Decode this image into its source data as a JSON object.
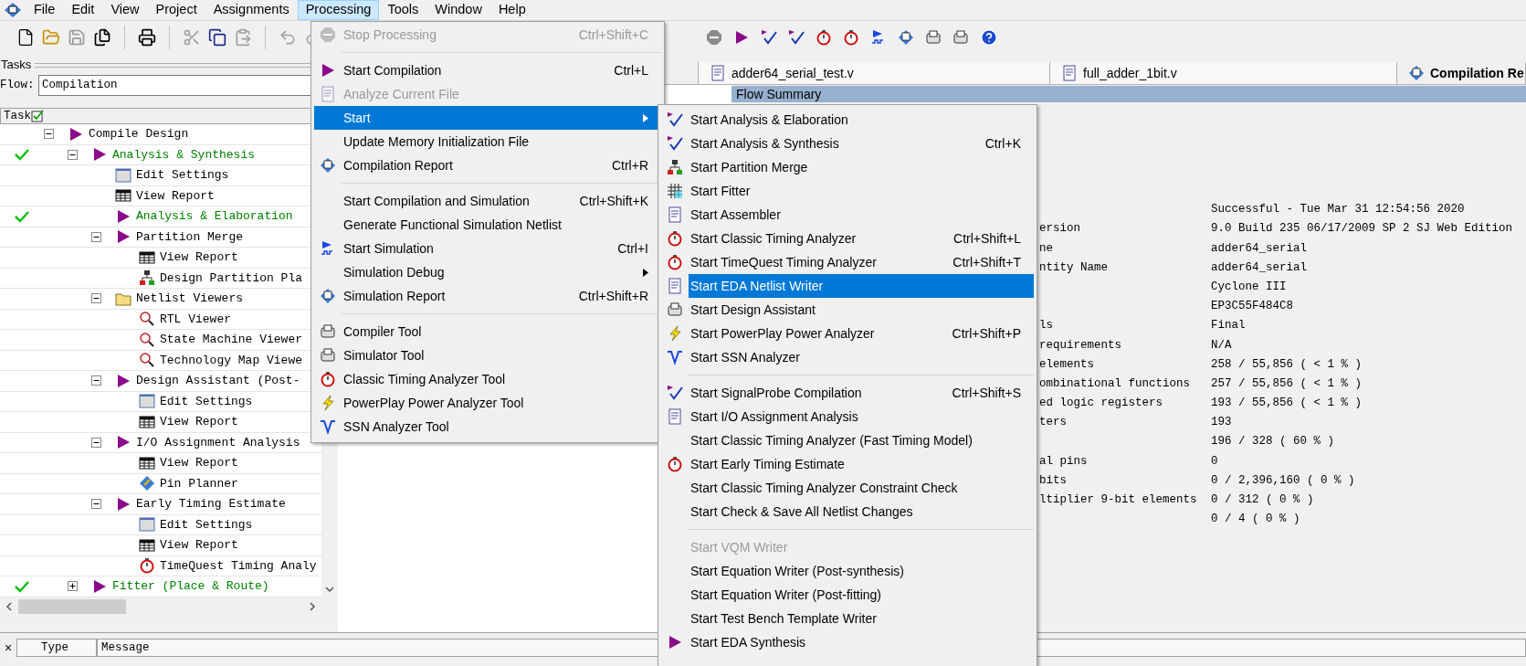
{
  "menubar": [
    {
      "label": "File",
      "selected": false
    },
    {
      "label": "Edit",
      "selected": false
    },
    {
      "label": "View",
      "selected": false
    },
    {
      "label": "Project",
      "selected": false
    },
    {
      "label": "Assignments",
      "selected": false
    },
    {
      "label": "Processing",
      "selected": true
    },
    {
      "label": "Tools",
      "selected": false
    },
    {
      "label": "Window",
      "selected": false
    },
    {
      "label": "Help",
      "selected": false
    }
  ],
  "tasks_panel": {
    "title": "Tasks",
    "flow_label": "Flow:",
    "flow_value": "Compilation",
    "column": "Task",
    "tree": [
      {
        "label": "Compile Design",
        "kind": "task",
        "done": false,
        "expanded": true,
        "children": [
          {
            "label": "Analysis & Synthesis",
            "kind": "task",
            "done": true,
            "expanded": true,
            "children": [
              {
                "label": "Edit Settings",
                "kind": "settings",
                "done": false
              },
              {
                "label": "View Report",
                "kind": "report",
                "done": false
              },
              {
                "label": "Analysis & Elaboration",
                "kind": "task",
                "done": true
              },
              {
                "label": "Partition Merge",
                "kind": "task",
                "done": false,
                "expanded": true,
                "children": [
                  {
                    "label": "View Report",
                    "kind": "report",
                    "done": false
                  },
                  {
                    "label": "Design Partition Pla",
                    "kind": "partition",
                    "done": false
                  }
                ]
              },
              {
                "label": "Netlist Viewers",
                "kind": "folder",
                "done": false,
                "expanded": true,
                "children": [
                  {
                    "label": "RTL Viewer",
                    "kind": "viewer",
                    "done": false
                  },
                  {
                    "label": "State Machine Viewer",
                    "kind": "viewer",
                    "done": false
                  },
                  {
                    "label": "Technology Map Viewe",
                    "kind": "viewer",
                    "done": false
                  }
                ]
              },
              {
                "label": "Design Assistant (Post-",
                "kind": "task",
                "done": false,
                "expanded": true,
                "children": [
                  {
                    "label": "Edit Settings",
                    "kind": "settings",
                    "done": false
                  },
                  {
                    "label": "View Report",
                    "kind": "report",
                    "done": false
                  }
                ]
              },
              {
                "label": "I/O Assignment Analysis",
                "kind": "task",
                "done": false,
                "expanded": true,
                "children": [
                  {
                    "label": "View Report",
                    "kind": "report",
                    "done": false
                  },
                  {
                    "label": "Pin Planner",
                    "kind": "planner",
                    "done": false
                  }
                ]
              },
              {
                "label": "Early Timing Estimate",
                "kind": "task",
                "done": false,
                "expanded": true,
                "children": [
                  {
                    "label": "Edit Settings",
                    "kind": "settings",
                    "done": false
                  },
                  {
                    "label": "View Report",
                    "kind": "report",
                    "done": false
                  },
                  {
                    "label": "TimeQuest Timing Analy",
                    "kind": "timing",
                    "done": false
                  }
                ]
              }
            ]
          },
          {
            "label": "Fitter (Place & Route)",
            "kind": "task",
            "done": true,
            "expanded": false
          }
        ]
      }
    ]
  },
  "tabs": [
    {
      "label": "adder64_serial_test.v",
      "selected": false
    },
    {
      "label": "full_adder_1bit.v",
      "selected": false
    },
    {
      "label": "Compilation Re",
      "selected": true
    }
  ],
  "summary": {
    "title": "Flow Summary",
    "rows": [
      {
        "value": "Successful - Tue Mar 31 12:54:56 2020"
      },
      {
        "label": "ersion",
        "value": "9.0 Build 235 06/17/2009 SP 2 SJ Web Edition"
      },
      {
        "label": "ne",
        "value": "adder64_serial"
      },
      {
        "label": "ntity Name",
        "value": "adder64_serial"
      },
      {
        "value": "Cyclone III"
      },
      {
        "value": "EP3C55F484C8"
      },
      {
        "label": "ls",
        "value": "Final"
      },
      {
        "label": "requirements",
        "value": "N/A"
      },
      {
        "label": "elements",
        "value": "258 / 55,856 ( < 1 % )"
      },
      {
        "label": "ombinational functions",
        "value": "257 / 55,856 ( < 1 % )"
      },
      {
        "label": "ed logic registers",
        "value": "193 / 55,856 ( < 1 % )"
      },
      {
        "label": "ters",
        "value": "193"
      },
      {
        "value": "196 / 328 ( 60 % )"
      },
      {
        "label": "al pins",
        "value": "0"
      },
      {
        "label": "bits",
        "value": "0 / 2,396,160 ( 0 % )"
      },
      {
        "label": "ltiplier 9-bit elements",
        "value": "0 / 312 ( 0 % )"
      },
      {
        "value": "0 / 4 ( 0 % )"
      }
    ]
  },
  "messages": {
    "close": "×",
    "columns": [
      "Type",
      "Message"
    ]
  },
  "processing_menu": [
    {
      "kind": "item",
      "label": "Stop Processing",
      "shortcut": "Ctrl+Shift+C",
      "disabled": true,
      "selected": false,
      "submenu": false
    },
    {
      "kind": "separator"
    },
    {
      "kind": "item",
      "label": "Start Compilation",
      "shortcut": "Ctrl+L",
      "disabled": false,
      "selected": false,
      "submenu": false
    },
    {
      "kind": "item",
      "label": "Analyze Current File",
      "disabled": true,
      "selected": false,
      "submenu": false
    },
    {
      "kind": "item",
      "label": "Start",
      "disabled": false,
      "selected": true,
      "submenu": true
    },
    {
      "kind": "item",
      "label": "Update Memory Initialization File",
      "disabled": false,
      "selected": false,
      "submenu": false
    },
    {
      "kind": "item",
      "label": "Compilation Report",
      "shortcut": "Ctrl+R",
      "disabled": false,
      "selected": false,
      "submenu": false
    },
    {
      "kind": "separator"
    },
    {
      "kind": "item",
      "label": "Start Compilation and Simulation",
      "shortcut": "Ctrl+Shift+K",
      "disabled": false,
      "selected": false,
      "submenu": false
    },
    {
      "kind": "item",
      "label": "Generate Functional Simulation Netlist",
      "disabled": false,
      "selected": false,
      "submenu": false
    },
    {
      "kind": "item",
      "label": "Start Simulation",
      "shortcut": "Ctrl+I",
      "disabled": false,
      "selected": false,
      "submenu": false
    },
    {
      "kind": "item",
      "label": "Simulation Debug",
      "disabled": false,
      "selected": false,
      "submenu": true
    },
    {
      "kind": "item",
      "label": "Simulation Report",
      "shortcut": "Ctrl+Shift+R",
      "disabled": false,
      "selected": false,
      "submenu": false
    },
    {
      "kind": "separator"
    },
    {
      "kind": "item",
      "label": "Compiler Tool",
      "disabled": false,
      "selected": false,
      "submenu": false
    },
    {
      "kind": "item",
      "label": "Simulator Tool",
      "disabled": false,
      "selected": false,
      "submenu": false
    },
    {
      "kind": "item",
      "label": "Classic Timing Analyzer Tool",
      "disabled": false,
      "selected": false,
      "submenu": false
    },
    {
      "kind": "item",
      "label": "PowerPlay Power Analyzer Tool",
      "disabled": false,
      "selected": false,
      "submenu": false
    },
    {
      "kind": "item",
      "label": "SSN Analyzer Tool",
      "disabled": false,
      "selected": false,
      "submenu": false
    }
  ],
  "start_submenu": [
    {
      "kind": "item",
      "label": "Start Analysis & Elaboration",
      "disabled": false,
      "selected": false
    },
    {
      "kind": "item",
      "label": "Start Analysis & Synthesis",
      "shortcut": "Ctrl+K",
      "disabled": false,
      "selected": false
    },
    {
      "kind": "item",
      "label": "Start Partition Merge",
      "disabled": false,
      "selected": false
    },
    {
      "kind": "item",
      "label": "Start Fitter",
      "disabled": false,
      "selected": false
    },
    {
      "kind": "item",
      "label": "Start Assembler",
      "disabled": false,
      "selected": false
    },
    {
      "kind": "item",
      "label": "Start Classic Timing Analyzer",
      "shortcut": "Ctrl+Shift+L",
      "disabled": false,
      "selected": false
    },
    {
      "kind": "item",
      "label": "Start TimeQuest Timing Analyzer",
      "shortcut": "Ctrl+Shift+T",
      "disabled": false,
      "selected": false
    },
    {
      "kind": "item",
      "label": "Start EDA Netlist Writer",
      "disabled": false,
      "selected": true
    },
    {
      "kind": "item",
      "label": "Start Design Assistant",
      "disabled": false,
      "selected": false
    },
    {
      "kind": "item",
      "label": "Start PowerPlay Power Analyzer",
      "shortcut": "Ctrl+Shift+P",
      "disabled": false,
      "selected": false
    },
    {
      "kind": "item",
      "label": "Start SSN Analyzer",
      "disabled": false,
      "selected": false
    },
    {
      "kind": "separator"
    },
    {
      "kind": "item",
      "label": "Start SignalProbe Compilation",
      "shortcut": "Ctrl+Shift+S",
      "disabled": false,
      "selected": false
    },
    {
      "kind": "item",
      "label": "Start I/O Assignment Analysis",
      "disabled": false,
      "selected": false
    },
    {
      "kind": "item",
      "label": "Start Classic Timing Analyzer (Fast Timing Model)",
      "disabled": false,
      "selected": false
    },
    {
      "kind": "item",
      "label": "Start Early Timing Estimate",
      "disabled": false,
      "selected": false
    },
    {
      "kind": "item",
      "label": "Start Classic Timing Analyzer Constraint Check",
      "disabled": false,
      "selected": false
    },
    {
      "kind": "item",
      "label": "Start Check & Save All Netlist Changes",
      "disabled": false,
      "selected": false
    },
    {
      "kind": "separator"
    },
    {
      "kind": "item",
      "label": "Start VQM Writer",
      "disabled": true,
      "selected": false
    },
    {
      "kind": "item",
      "label": "Start Equation Writer (Post-synthesis)",
      "disabled": false,
      "selected": false
    },
    {
      "kind": "item",
      "label": "Start Equation Writer (Post-fitting)",
      "disabled": false,
      "selected": false
    },
    {
      "kind": "item",
      "label": "Start Test Bench Template Writer",
      "disabled": false,
      "selected": false
    },
    {
      "kind": "item",
      "label": "Start EDA Synthesis",
      "disabled": false,
      "selected": false
    }
  ]
}
